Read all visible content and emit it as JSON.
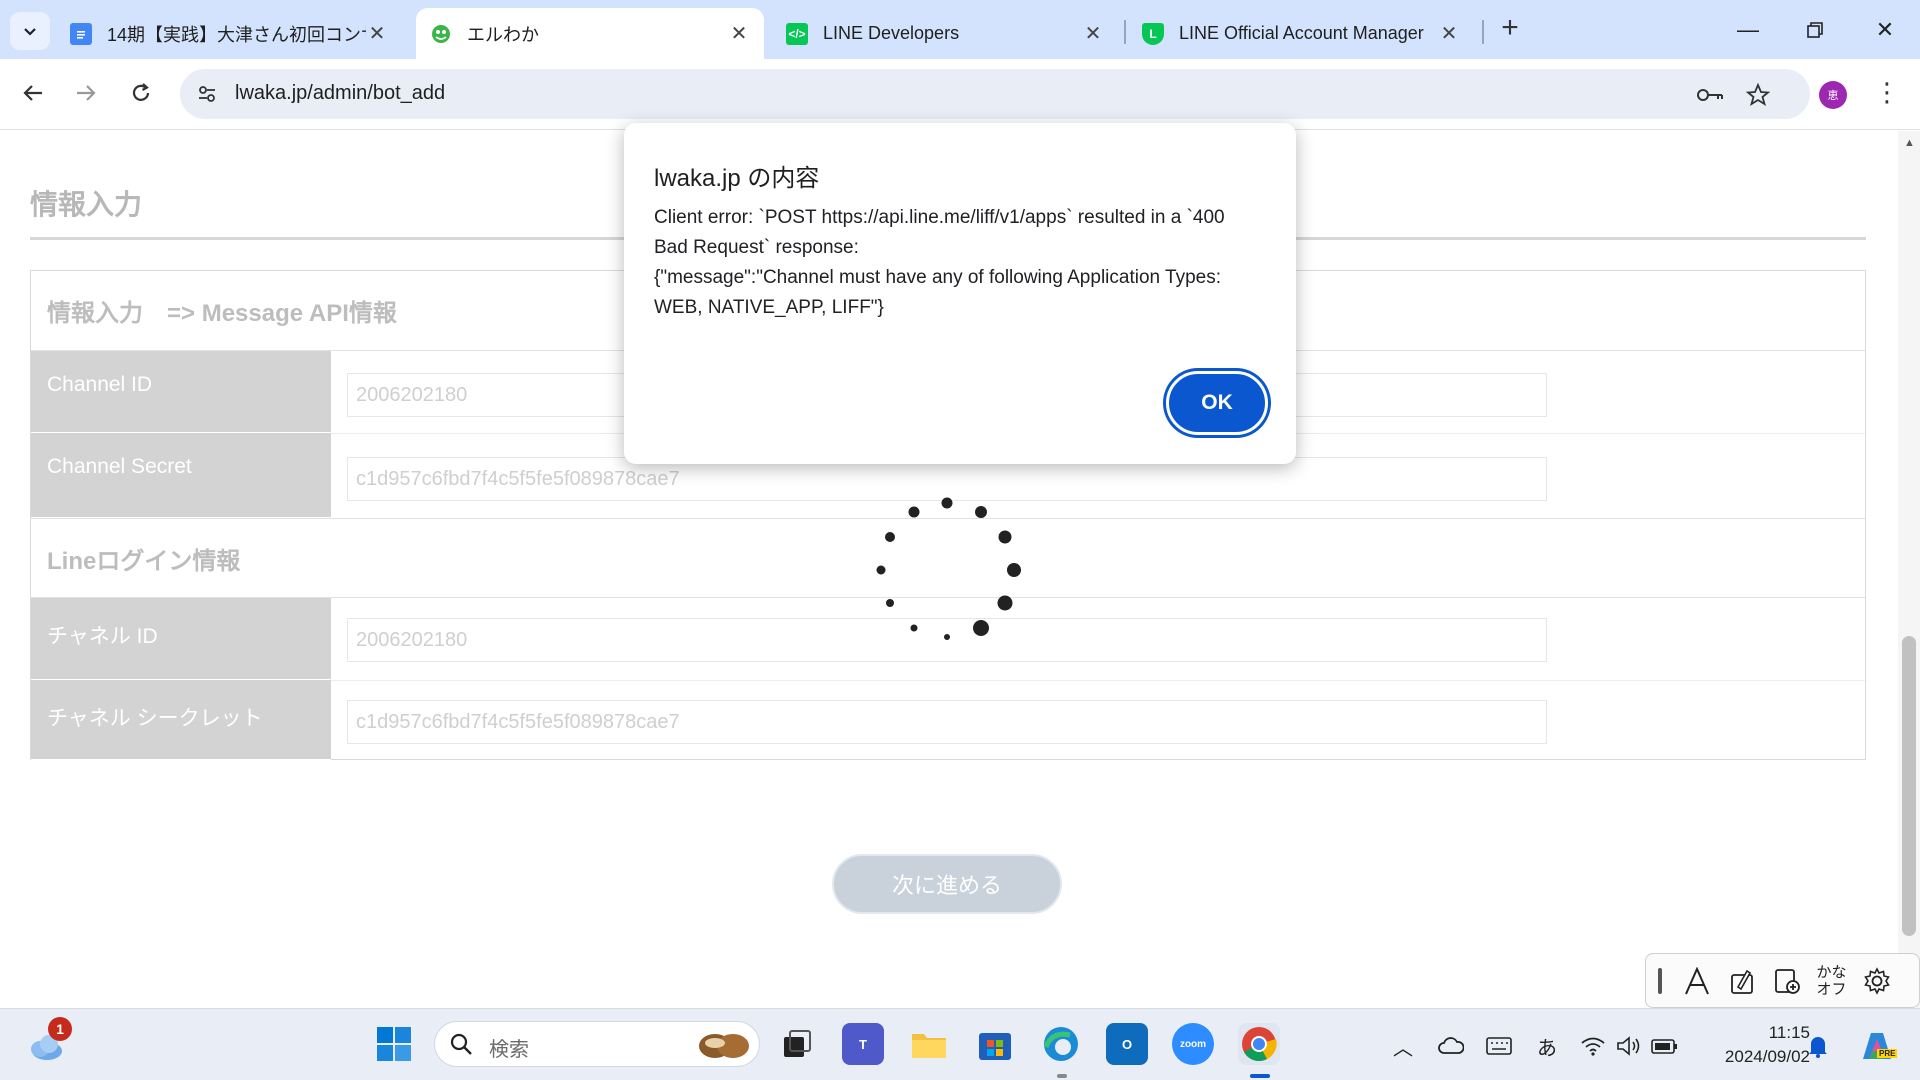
{
  "browser": {
    "tabs": [
      {
        "label": "14期【実践】大津さん初回コンサル",
        "favicon": "docs-icon",
        "active": false
      },
      {
        "label": "エルわか",
        "favicon": "erwaka-icon",
        "active": true
      },
      {
        "label": "LINE Developers",
        "favicon": "line-developers-icon",
        "active": false
      },
      {
        "label": "LINE Official Account Manager",
        "favicon": "line-oa-icon",
        "active": false
      }
    ],
    "url": "lwaka.jp/admin/bot_add",
    "avatar_text": "恵"
  },
  "page": {
    "section_title": "情報入力",
    "message_api_heading": "情報入力　=> Message API情報",
    "channel_id_label": "Channel ID",
    "channel_id_value": "2006202180",
    "channel_secret_label": "Channel Secret",
    "channel_secret_value": "c1d957c6fbd7f4c5f5fe5f089878cae7",
    "line_login_heading": "Lineログイン情報",
    "login_channel_id_label": "チャネル ID",
    "login_channel_id_value": "2006202180",
    "login_channel_secret_label": "チャネル シークレット",
    "login_channel_secret_value": "c1d957c6fbd7f4c5f5fe5f089878cae7",
    "next_button": "次に進める"
  },
  "dialog": {
    "title": "lwaka.jp の内容",
    "message": "Client error: `POST https://api.line.me/liff/v1/apps` resulted in a `400\nBad Request` response:\n{\"message\":\"Channel must have any of following Application Types:\nWEB, NATIVE_APP, LIFF\"}",
    "ok_label": "OK"
  },
  "ime": {
    "kana_label_1": "かな",
    "kana_label_2": "オフ"
  },
  "taskbar": {
    "search_placeholder": "検索",
    "weather_badge": "1",
    "ime_mode": "あ",
    "time": "11:15",
    "date": "2024/09/02",
    "copilot_badge": "PRE"
  },
  "colors": {
    "tabstrip": "#d3e3fd",
    "omnibox": "#e9eef6",
    "accent": "#0b57d0",
    "label_bg": "#d3d3d3"
  }
}
